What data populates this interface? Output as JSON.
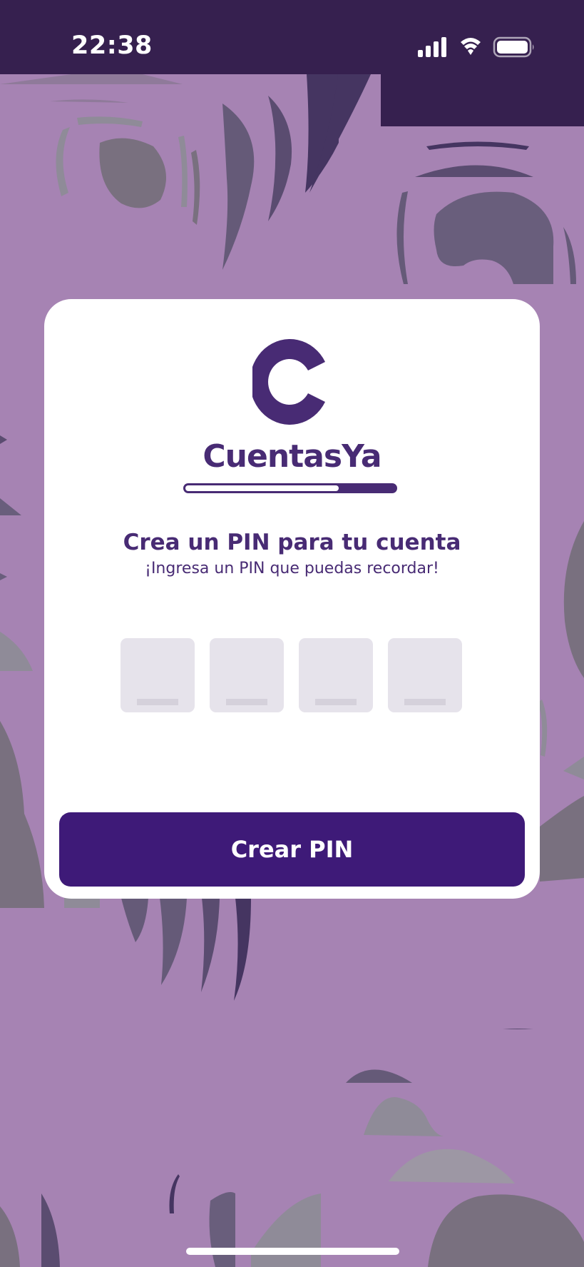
{
  "status_bar": {
    "time": "22:38",
    "icons": [
      "cellular-signal-icon",
      "wifi-icon",
      "battery-icon"
    ]
  },
  "card": {
    "brand_name": "CuentasYa",
    "progress": 0.73,
    "title": "Crea un PIN para tu cuenta",
    "subtitle": "¡Ingresa un PIN que puedas recordar!",
    "pin_fields": [
      {
        "value": ""
      },
      {
        "value": ""
      },
      {
        "value": ""
      },
      {
        "value": ""
      }
    ],
    "button_label": "Crear PIN"
  },
  "colors": {
    "brand_purple": "#482b74",
    "button_purple": "#3e1a78",
    "status_bar": "#36204f",
    "background": "#a683b3",
    "pin_box": "#e6e3eb"
  }
}
